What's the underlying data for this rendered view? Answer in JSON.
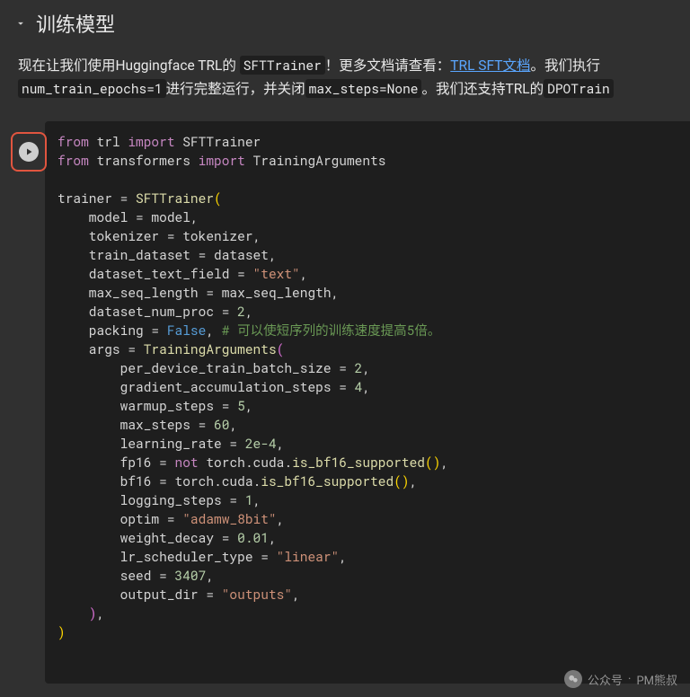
{
  "section": {
    "title": "训练模型"
  },
  "description": {
    "pre": "现在让我们使用Huggingface TRL的",
    "code1": "SFTTrainer",
    "mid1": "！更多文档请查看：",
    "link_text": "TRL SFT文档",
    "mid2": "。我们执行",
    "code2": "num_train_epochs=1",
    "mid3": "进行完整运行，并关闭",
    "code3": "max_steps=None",
    "mid4": "。我们还支持TRL的",
    "code4": "DPOTrain"
  },
  "code": {
    "lines": [
      [
        [
          "keyword",
          "from"
        ],
        [
          "plain",
          " trl "
        ],
        [
          "keyword",
          "import"
        ],
        [
          "plain",
          " SFTTrainer"
        ]
      ],
      [
        [
          "keyword",
          "from"
        ],
        [
          "plain",
          " transformers "
        ],
        [
          "keyword",
          "import"
        ],
        [
          "plain",
          " TrainingArguments"
        ]
      ],
      [
        [
          "plain",
          ""
        ]
      ],
      [
        [
          "plain",
          "trainer = "
        ],
        [
          "func",
          "SFTTrainer"
        ],
        [
          "paren",
          "("
        ]
      ],
      [
        [
          "plain",
          "    model = model,"
        ]
      ],
      [
        [
          "plain",
          "    tokenizer = tokenizer,"
        ]
      ],
      [
        [
          "plain",
          "    train_dataset = dataset,"
        ]
      ],
      [
        [
          "plain",
          "    dataset_text_field = "
        ],
        [
          "string",
          "\"text\""
        ],
        [
          "plain",
          ","
        ]
      ],
      [
        [
          "plain",
          "    max_seq_length = max_seq_length,"
        ]
      ],
      [
        [
          "plain",
          "    dataset_num_proc = "
        ],
        [
          "number",
          "2"
        ],
        [
          "plain",
          ","
        ]
      ],
      [
        [
          "plain",
          "    packing = "
        ],
        [
          "bool",
          "False"
        ],
        [
          "plain",
          ", "
        ],
        [
          "comment",
          "# 可以使短序列的训练速度提高5倍。"
        ]
      ],
      [
        [
          "plain",
          "    args = "
        ],
        [
          "func",
          "TrainingArguments"
        ],
        [
          "paren2",
          "("
        ]
      ],
      [
        [
          "plain",
          "        per_device_train_batch_size = "
        ],
        [
          "number",
          "2"
        ],
        [
          "plain",
          ","
        ]
      ],
      [
        [
          "plain",
          "        gradient_accumulation_steps = "
        ],
        [
          "number",
          "4"
        ],
        [
          "plain",
          ","
        ]
      ],
      [
        [
          "plain",
          "        warmup_steps = "
        ],
        [
          "number",
          "5"
        ],
        [
          "plain",
          ","
        ]
      ],
      [
        [
          "plain",
          "        max_steps = "
        ],
        [
          "number",
          "60"
        ],
        [
          "plain",
          ","
        ]
      ],
      [
        [
          "plain",
          "        learning_rate = "
        ],
        [
          "number",
          "2e-4"
        ],
        [
          "plain",
          ","
        ]
      ],
      [
        [
          "plain",
          "        fp16 = "
        ],
        [
          "keyword",
          "not"
        ],
        [
          "plain",
          " torch.cuda."
        ],
        [
          "func",
          "is_bf16_supported"
        ],
        [
          "paren",
          "()"
        ],
        [
          "plain",
          ","
        ]
      ],
      [
        [
          "plain",
          "        bf16 = torch.cuda."
        ],
        [
          "func",
          "is_bf16_supported"
        ],
        [
          "paren",
          "()"
        ],
        [
          "plain",
          ","
        ]
      ],
      [
        [
          "plain",
          "        logging_steps = "
        ],
        [
          "number",
          "1"
        ],
        [
          "plain",
          ","
        ]
      ],
      [
        [
          "plain",
          "        optim = "
        ],
        [
          "string",
          "\"adamw_8bit\""
        ],
        [
          "plain",
          ","
        ]
      ],
      [
        [
          "plain",
          "        weight_decay = "
        ],
        [
          "number",
          "0.01"
        ],
        [
          "plain",
          ","
        ]
      ],
      [
        [
          "plain",
          "        lr_scheduler_type = "
        ],
        [
          "string",
          "\"linear\""
        ],
        [
          "plain",
          ","
        ]
      ],
      [
        [
          "plain",
          "        seed = "
        ],
        [
          "number",
          "3407"
        ],
        [
          "plain",
          ","
        ]
      ],
      [
        [
          "plain",
          "        output_dir = "
        ],
        [
          "string",
          "\"outputs\""
        ],
        [
          "plain",
          ","
        ]
      ],
      [
        [
          "plain",
          "    "
        ],
        [
          "paren2",
          ")"
        ],
        [
          "plain",
          ","
        ]
      ],
      [
        [
          "paren",
          ")"
        ]
      ]
    ]
  },
  "watermark": {
    "label": "公众号",
    "dot": "·",
    "author": "PM熊叔"
  }
}
